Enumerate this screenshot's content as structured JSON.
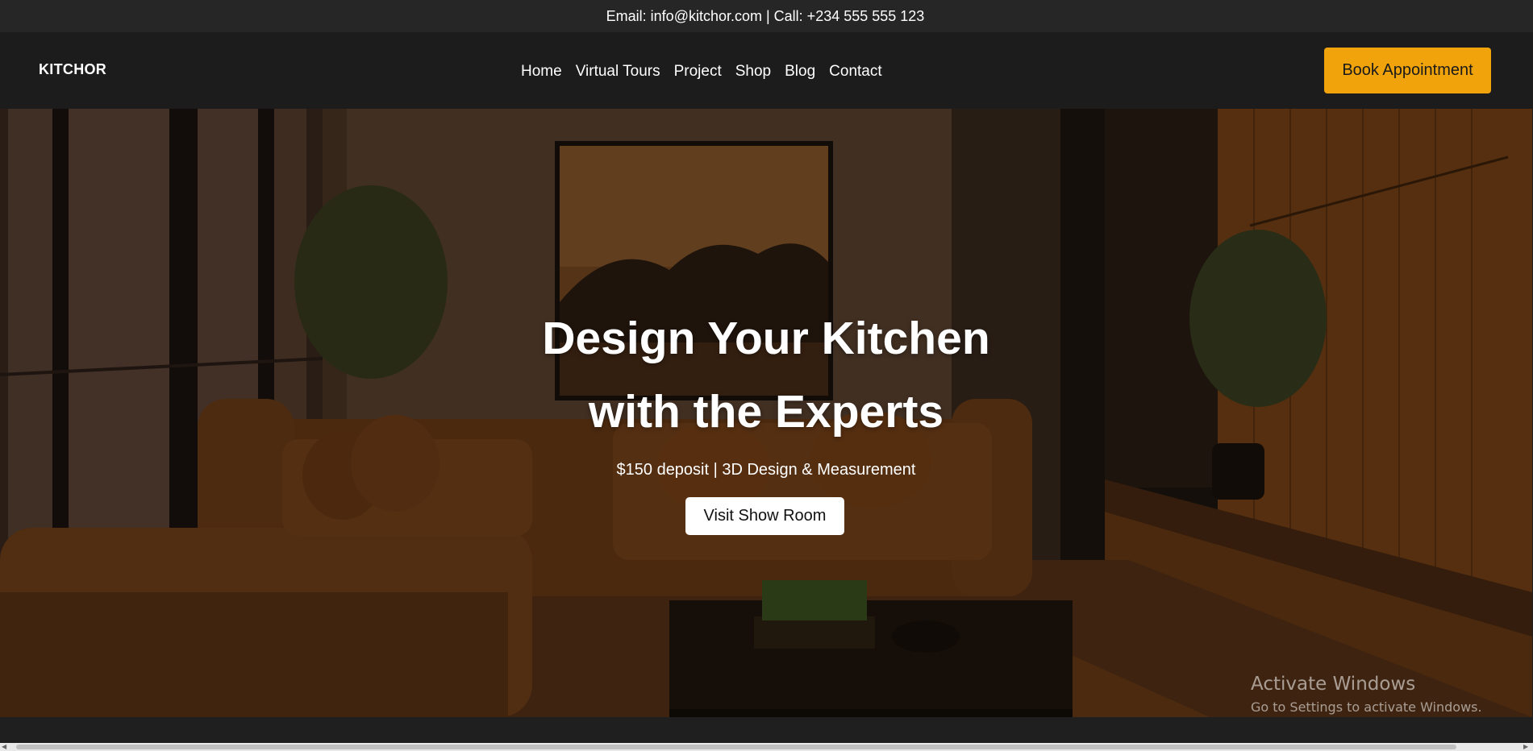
{
  "topbar": {
    "contact": "Email: info@kitchor.com | Call: +234 555 555 123"
  },
  "nav": {
    "logo": "KITCHOR",
    "items": [
      {
        "label": "Home"
      },
      {
        "label": "Virtual Tours"
      },
      {
        "label": "Project"
      },
      {
        "label": "Shop"
      },
      {
        "label": "Blog"
      },
      {
        "label": "Contact"
      }
    ],
    "cta": "Book Appointment"
  },
  "hero": {
    "title_line1": "Design Your Kitchen",
    "title_line2": "with the Experts",
    "subtitle": "$150 deposit | 3D Design & Measurement",
    "button": "Visit Show Room",
    "background": "living-room-photo"
  },
  "watermark": {
    "line1": "Activate Windows",
    "line2": "Go to Settings to activate Windows."
  },
  "colors": {
    "accent": "#f0a30a",
    "topbar": "#262626",
    "navbar": "#1c1c1c"
  }
}
